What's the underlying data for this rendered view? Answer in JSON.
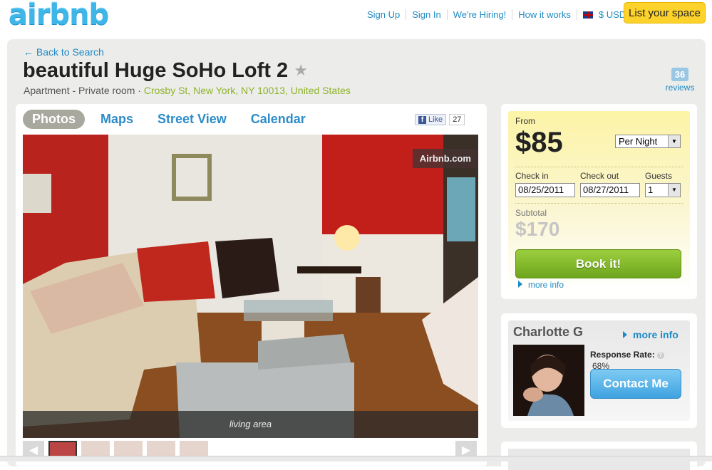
{
  "header": {
    "logo": "airbnb",
    "nav": [
      "Sign Up",
      "Sign In",
      "We're Hiring!",
      "How it works"
    ],
    "currency": "$ USD",
    "list_space": "List your space"
  },
  "listing": {
    "back": "Back to Search",
    "title": "beautiful Huge SoHo Loft 2",
    "type": "Apartment - Private room",
    "location": "Crosby St, New York, NY 10013, United States",
    "reviews_count": "36",
    "reviews_label": "reviews"
  },
  "photos": {
    "tabs": [
      "Photos",
      "Maps",
      "Street View",
      "Calendar"
    ],
    "like_label": "Like",
    "like_count": "27",
    "watermark": "Airbnb.com",
    "caption": "living area"
  },
  "booking": {
    "from": "From",
    "price": "$85",
    "period": "Per Night",
    "checkin_label": "Check in",
    "checkin": "08/25/2011",
    "checkout_label": "Check out",
    "checkout": "08/27/2011",
    "guests_label": "Guests",
    "guests": "1",
    "subtotal_label": "Subtotal",
    "subtotal": "$170",
    "book_button": "Book it!",
    "more_info": "more info"
  },
  "host": {
    "name": "Charlotte G",
    "more_info": "more info",
    "response_rate_label": "Response Rate:",
    "response_rate": "68%",
    "contact": "Contact Me"
  },
  "colors": {
    "link_blue": "#1f8bc4",
    "book_green": "#7ab82a",
    "list_yellow": "#fdd22a"
  }
}
